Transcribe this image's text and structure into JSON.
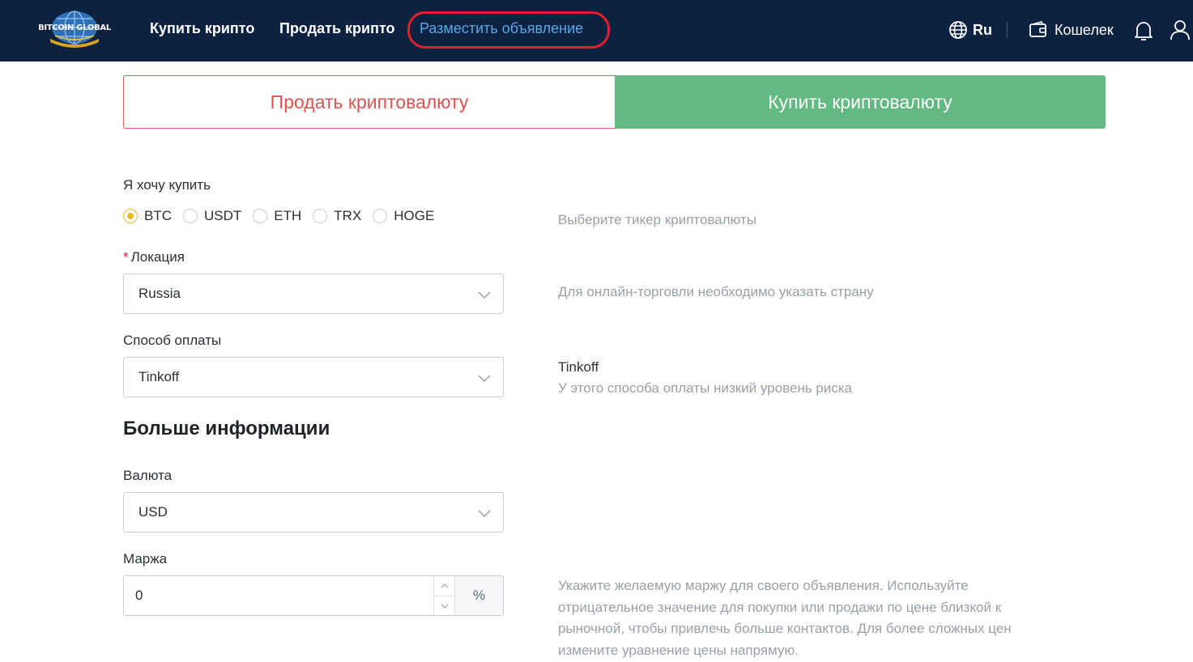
{
  "header": {
    "logo_text": "BITCOIN GLOBAL",
    "nav": [
      {
        "label": "Купить крипто"
      },
      {
        "label": "Продать крипто"
      },
      {
        "label": "Разместить объявление"
      }
    ],
    "language": "Ru",
    "wallet_label": "Кошелек"
  },
  "tabs": {
    "sell": "Продать криптовалюту",
    "buy": "Купить криптовалюту"
  },
  "form": {
    "want_label": "Я хочу купить",
    "tickers": [
      "BTC",
      "USDT",
      "ETH",
      "TRX",
      "HOGE"
    ],
    "selected_ticker": "BTC",
    "ticker_hint": "Выберите тикер криптовалюты",
    "location_label": "Локация",
    "location_value": "Russia",
    "location_hint": "Для онлайн-торговли необходимо указать страну",
    "payment_label": "Способ оплаты",
    "payment_value": "Tinkoff",
    "payment_hint_title": "Tinkoff",
    "payment_hint_text": "У этого способа оплаты низкий уровень риска",
    "more_info_title": "Больше информации",
    "currency_label": "Валюта",
    "currency_value": "USD",
    "margin_label": "Маржа",
    "margin_value": "0",
    "margin_unit": "%",
    "margin_hint": "Укажите желаемую маржу для своего объявления. Используйте отрицательное значение для покупки или продажи по цене близкой к рыночной, чтобы привлечь больше контактов. Для более сложных цен измените уравнение цены напрямую."
  },
  "colors": {
    "header_bg": "#0d2240",
    "accent_green": "#62b982",
    "sell_red": "#d9534f",
    "active_nav": "#5aa8e6",
    "radio_checked": "#e8b923"
  }
}
